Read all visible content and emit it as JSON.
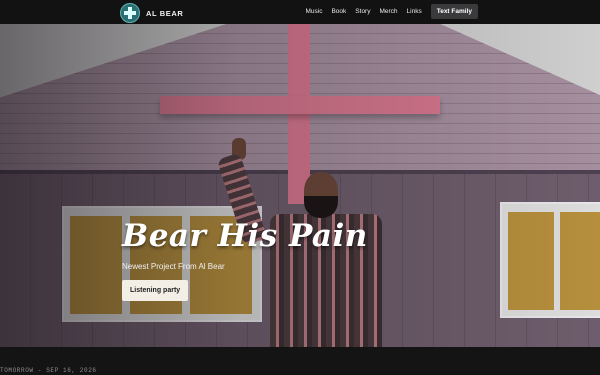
{
  "brand": {
    "name": "AL BEAR",
    "logo_icon": "cross-logo-icon"
  },
  "nav": {
    "links": [
      "Music",
      "Book",
      "Story",
      "Merch",
      "Links"
    ],
    "cta_label": "Text Family"
  },
  "hero": {
    "headline": "Bear His Pain",
    "subheading": "Newest Project From Al Bear",
    "cta_label": "Listening party"
  },
  "footer_strip": {
    "event_text": "TOMORROW - SEP 16, 2026"
  },
  "colors": {
    "nav_bg": "#121212",
    "cross": "#d7778e",
    "cta_bg": "#f3eee6",
    "nav_button_bg": "#3a3a3c"
  }
}
